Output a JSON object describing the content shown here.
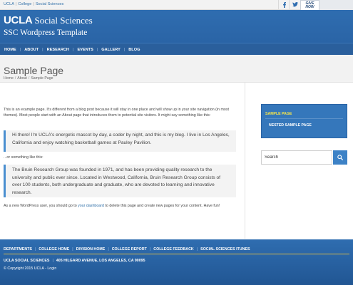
{
  "topbar": {
    "links": [
      "UCLA",
      "College",
      "Social Sciences"
    ],
    "give_badge": [
      "GIVE",
      "NOW"
    ]
  },
  "header": {
    "logo_text": "UCLA",
    "unit_name": "Social Sciences",
    "subtitle": "SSC Wordpress Template"
  },
  "nav": {
    "items": [
      "HOME",
      "ABOUT",
      "RESEARCH",
      "EVENTS",
      "GALLERY",
      "BLOG"
    ]
  },
  "page": {
    "title": "Sample Page",
    "breadcrumb": [
      "Home",
      "About",
      "Sample Page"
    ]
  },
  "content": {
    "intro": "This is an example page. It's different from a blog post because it will stay in one place and will show up in your site navigation (in most themes). Most people start with an About page that introduces them to potential site visitors. It might say something like this:",
    "quote1": "Hi there! I'm UCLA's energetic mascot by day, a coder by night, and this is my blog. I live in Los Angeles, California and enjoy watching basketball games at Pauley Pavilion.",
    "or_text": "...or something like this:",
    "quote2": "The Bruin Research Group was founded in 1971, and has been providing quality research to the university and public ever since. Located in Westwood, California, Bruin Research Group consists of over 100 students, both undergraduate and graduate, who are devoted to learning and innovative research.",
    "outro_before": "As a new WordPress user, you should go to ",
    "outro_link": "your dashboard",
    "outro_after": " to delete this page and create new pages for your content. Have fun!"
  },
  "sidebar": {
    "subnav": [
      "SAMPLE PAGE",
      "NESTED SAMPLE PAGE"
    ],
    "search_placeholder": "Search"
  },
  "footer": {
    "links": [
      "DEPARTMENTS",
      "COLLEGE HOME",
      "DIVISION HOME",
      "COLLEGE REPORT",
      "COLLEGE FEEDBACK",
      "SOCIAL SCIENCES ITUNES"
    ],
    "org": "UCLA SOCIAL SCIENCES",
    "address": "405 HILGARD AVENUE, LOS ANGELES, CA 90095",
    "copyright": "© Copyright 2015 UCLA - Login"
  },
  "colors": {
    "brand_blue": "#2f6db0",
    "nav_blue": "#2a5f9c",
    "accent_yellow": "#f5e44a",
    "link_blue": "#2f6fa8"
  }
}
